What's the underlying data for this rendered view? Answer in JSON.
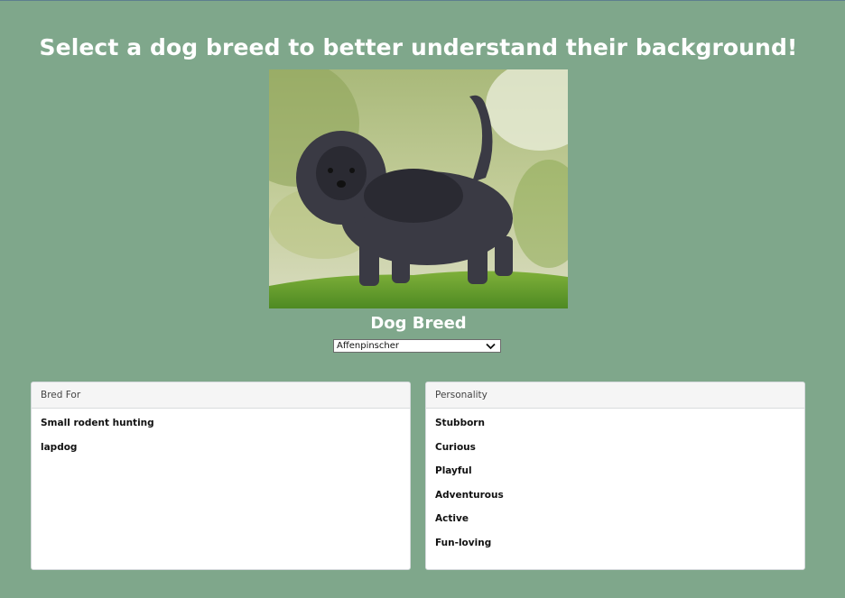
{
  "page": {
    "title": "Select a dog breed to better understand their background!"
  },
  "image": {
    "subject": "Affenpinscher dog standing on grass"
  },
  "breed_selector": {
    "label": "Dog Breed",
    "selected": "Affenpinscher"
  },
  "bred_for": {
    "header": "Bred For",
    "items": [
      "Small rodent hunting",
      "lapdog"
    ]
  },
  "personality": {
    "header": "Personality",
    "items": [
      "Stubborn",
      "Curious",
      "Playful",
      "Adventurous",
      "Active",
      "Fun-loving"
    ]
  },
  "colors": {
    "background": "#7fa78b",
    "card": "#ffffff",
    "card_header": "#f5f5f5"
  }
}
